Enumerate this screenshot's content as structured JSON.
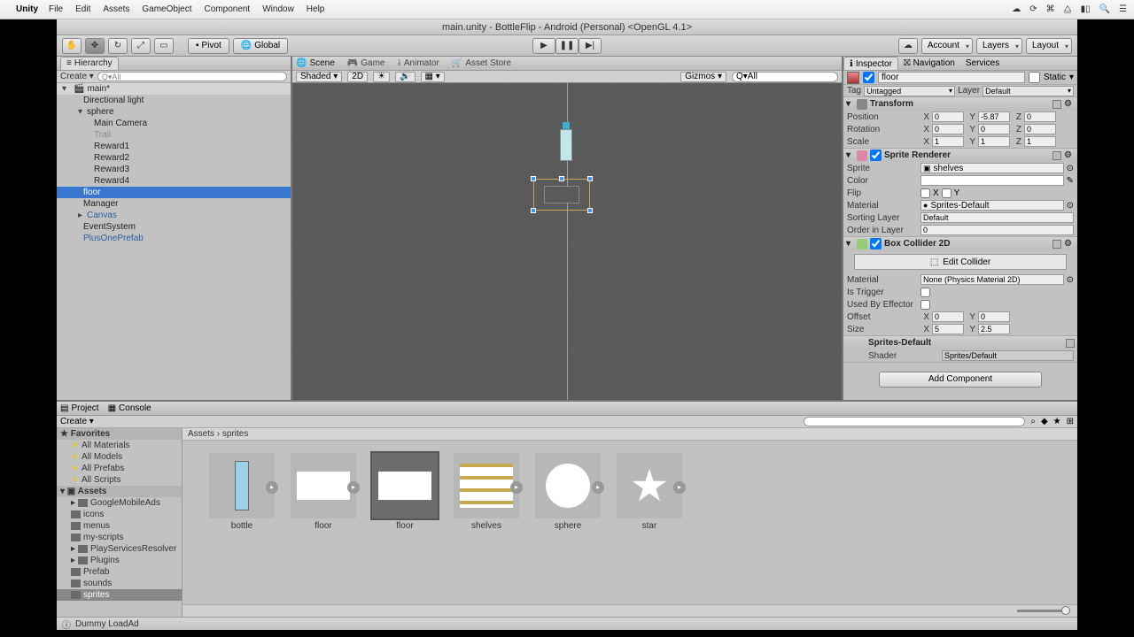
{
  "mac": {
    "app": "Unity",
    "menus": [
      "File",
      "Edit",
      "Assets",
      "GameObject",
      "Component",
      "Window",
      "Help"
    ]
  },
  "window": {
    "title": "main.unity - BottleFlip - Android (Personal) <OpenGL 4.1>"
  },
  "toolbar": {
    "pivot": "Pivot",
    "global": "Global",
    "account": "Account",
    "layers": "Layers",
    "layout": "Layout"
  },
  "hierarchy": {
    "title": "Hierarchy",
    "create": "Create",
    "searchPH": "Q▾All",
    "scene": "main*",
    "items": [
      "Directional light",
      "sphere",
      "Main Camera",
      "Trail",
      "Reward1",
      "Reward2",
      "Reward3",
      "Reward4",
      "floor",
      "Manager",
      "Canvas",
      "EventSystem",
      "PlusOnePrefab"
    ]
  },
  "sceneTabs": {
    "scene": "Scene",
    "game": "Game",
    "animator": "Animator",
    "store": "Asset Store"
  },
  "sceneBar": {
    "shading": "Shaded",
    "mode": "2D",
    "gizmos": "Gizmos",
    "searchPH": "Q▾All"
  },
  "inspector": {
    "tabs": {
      "inspector": "Inspector",
      "nav": "Navigation",
      "services": "Services"
    },
    "objName": "floor",
    "static": "Static",
    "tag": {
      "lbl": "Tag",
      "val": "Untagged"
    },
    "layer": {
      "lbl": "Layer",
      "val": "Default"
    },
    "transform": {
      "title": "Transform",
      "pos": "Position",
      "rot": "Rotation",
      "scale": "Scale",
      "px": "0",
      "py": "-5.87",
      "pz": "0",
      "rx": "0",
      "ry": "0",
      "rz": "0",
      "sx": "1",
      "sy": "1",
      "sz": "1"
    },
    "sprite": {
      "title": "Sprite Renderer",
      "spriteL": "Sprite",
      "spriteV": "shelves",
      "colorL": "Color",
      "flipL": "Flip",
      "matL": "Material",
      "matV": "Sprites-Default",
      "sortL": "Sorting Layer",
      "sortV": "Default",
      "orderL": "Order in Layer",
      "orderV": "0"
    },
    "box": {
      "title": "Box Collider 2D",
      "edit": "Edit Collider",
      "matL": "Material",
      "matV": "None (Physics Material 2D)",
      "trigL": "Is Trigger",
      "effL": "Used By Effector",
      "offL": "Offset",
      "ox": "0",
      "oy": "0",
      "sizeL": "Size",
      "sx": "5",
      "sy": "2.5"
    },
    "mat": {
      "name": "Sprites-Default",
      "shaderL": "Shader",
      "shaderV": "Sprites/Default"
    },
    "add": "Add Component"
  },
  "project": {
    "tabs": {
      "project": "Project",
      "console": "Console"
    },
    "create": "Create",
    "fav": {
      "hdr": "Favorites",
      "items": [
        "All Materials",
        "All Models",
        "All Prefabs",
        "All Scripts"
      ]
    },
    "assets": {
      "hdr": "Assets",
      "items": [
        "GoogleMobileAds",
        "icons",
        "menus",
        "my-scripts",
        "PlayServicesResolver",
        "Plugins",
        "Prefab",
        "sounds",
        "sprites"
      ]
    },
    "breadcrumb": "Assets  ›  sprites",
    "thumbs": [
      "bottle",
      "floor",
      "floor",
      "shelves",
      "sphere",
      "star"
    ]
  },
  "status": "Dummy LoadAd"
}
